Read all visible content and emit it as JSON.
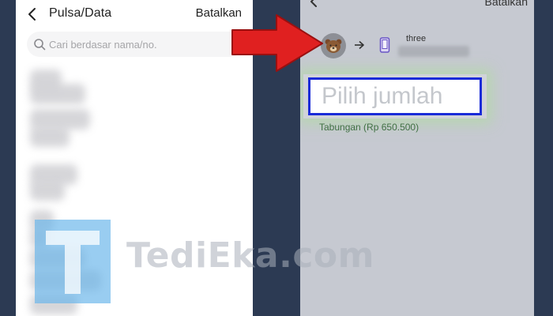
{
  "left_screen": {
    "title": "Pulsa/Data",
    "cancel_label": "Batalkan",
    "search": {
      "placeholder": "Cari berdasar nama/no.",
      "value": ""
    },
    "contact_count_visible": 11
  },
  "right_screen": {
    "cancel_label": "Batalkan",
    "recipient": {
      "operator": "three"
    },
    "amount_field": {
      "placeholder": "Pilih jumlah",
      "value": ""
    },
    "balance_text": "Tabungan (Rp 650.500)"
  },
  "watermark": {
    "text": "TediEka.com",
    "logo_letter": "T"
  },
  "colors": {
    "pointer_arrow": "#e02020",
    "highlight_border": "#1a2bd8",
    "highlight_glow": "#ace098",
    "watermark_logo": "#68b6eb",
    "balance_text": "#3f6f42"
  },
  "icons": {
    "back": "chevron-left-icon",
    "search": "search-icon",
    "avatar": "bear-icon",
    "transfer": "arrow-right-icon",
    "phone": "phone-icon",
    "pointer": "pointer-arrow-icon"
  }
}
